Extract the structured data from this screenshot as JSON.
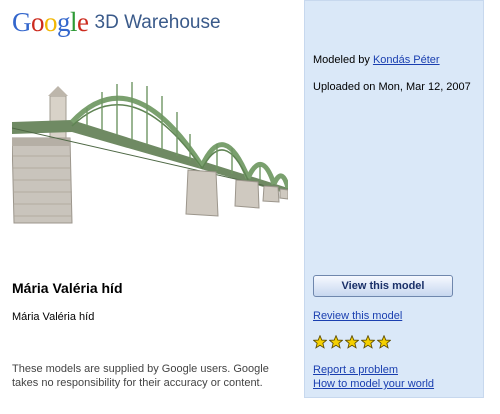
{
  "brand": {
    "logo_letters": [
      {
        "ch": "G",
        "color": "#3366cc"
      },
      {
        "ch": "o",
        "color": "#cc2b1e"
      },
      {
        "ch": "o",
        "color": "#f2b705"
      },
      {
        "ch": "g",
        "color": "#3366cc"
      },
      {
        "ch": "l",
        "color": "#2d9a36"
      },
      {
        "ch": "e",
        "color": "#cc2b1e"
      }
    ],
    "product": "3D Warehouse"
  },
  "model": {
    "title": "Mária Valéria híd",
    "description": "Mária Valéria híd",
    "modeled_by_label": "Modeled by",
    "author": "Kondás Péter",
    "uploaded": "Uploaded on Mon, Mar 12, 2007",
    "rating_stars": 5,
    "rating_max": 5
  },
  "disclaimer": "These models are supplied by Google users. Google takes no responsibility for their accuracy or content.",
  "actions": {
    "view_label": "View this model",
    "review_label": "Review this model",
    "report_label": "Report a problem",
    "howto_label": "How to model your world"
  },
  "colors": {
    "sidebar_bg": "#dae8f8",
    "link": "#1a3fb0",
    "star": "#f5d000"
  }
}
